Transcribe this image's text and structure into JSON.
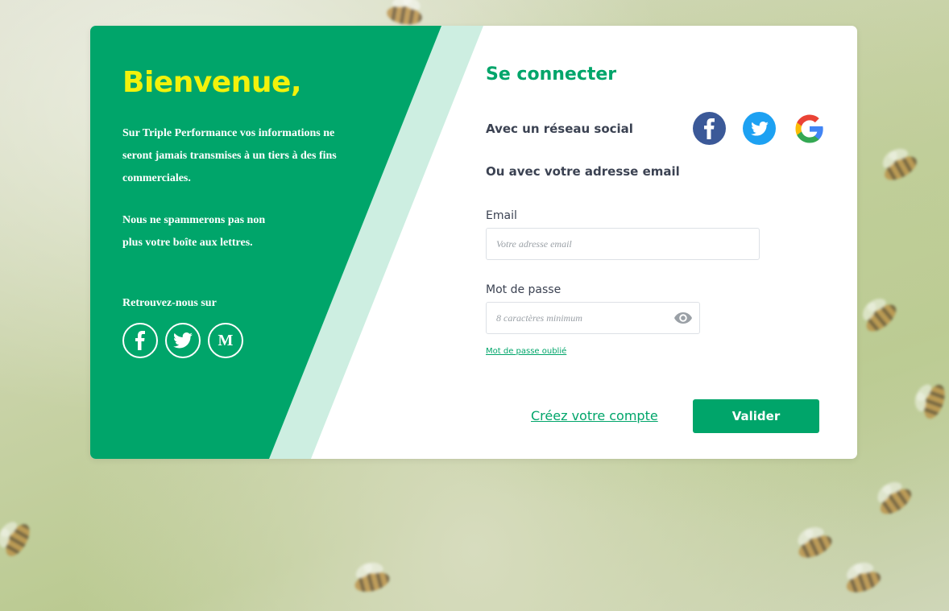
{
  "welcome": {
    "title": "Bienvenue,",
    "paragraph1": "Sur Triple Performance vos informations ne seront jamais transmises à un tiers à des fins commerciales.",
    "paragraph2": "Nous ne spammerons pas non plus votre boîte aux lettres.",
    "follow_label": "Retrouvez-nous sur",
    "follow_icons": [
      "facebook-icon",
      "twitter-icon",
      "medium-icon"
    ],
    "medium_letter": "M"
  },
  "login": {
    "title": "Se connecter",
    "social_label": "Avec un réseau social",
    "social_icons": [
      "facebook-icon",
      "twitter-icon",
      "google-icon"
    ],
    "email_section_label": "Ou avec votre adresse email",
    "email": {
      "label": "Email",
      "placeholder": "Votre adresse email",
      "value": ""
    },
    "password": {
      "label": "Mot de passe",
      "placeholder": "8 caractères minimum",
      "value": ""
    },
    "forgot_password": "Mot de passe oublié",
    "create_account": "Créez votre compte",
    "submit": "Valider"
  },
  "colors": {
    "brand_green": "#00a56a",
    "stripe": "#cdeee1",
    "title_yellow": "#f2f20b",
    "facebook": "#3b5998",
    "twitter": "#1da1f2"
  }
}
